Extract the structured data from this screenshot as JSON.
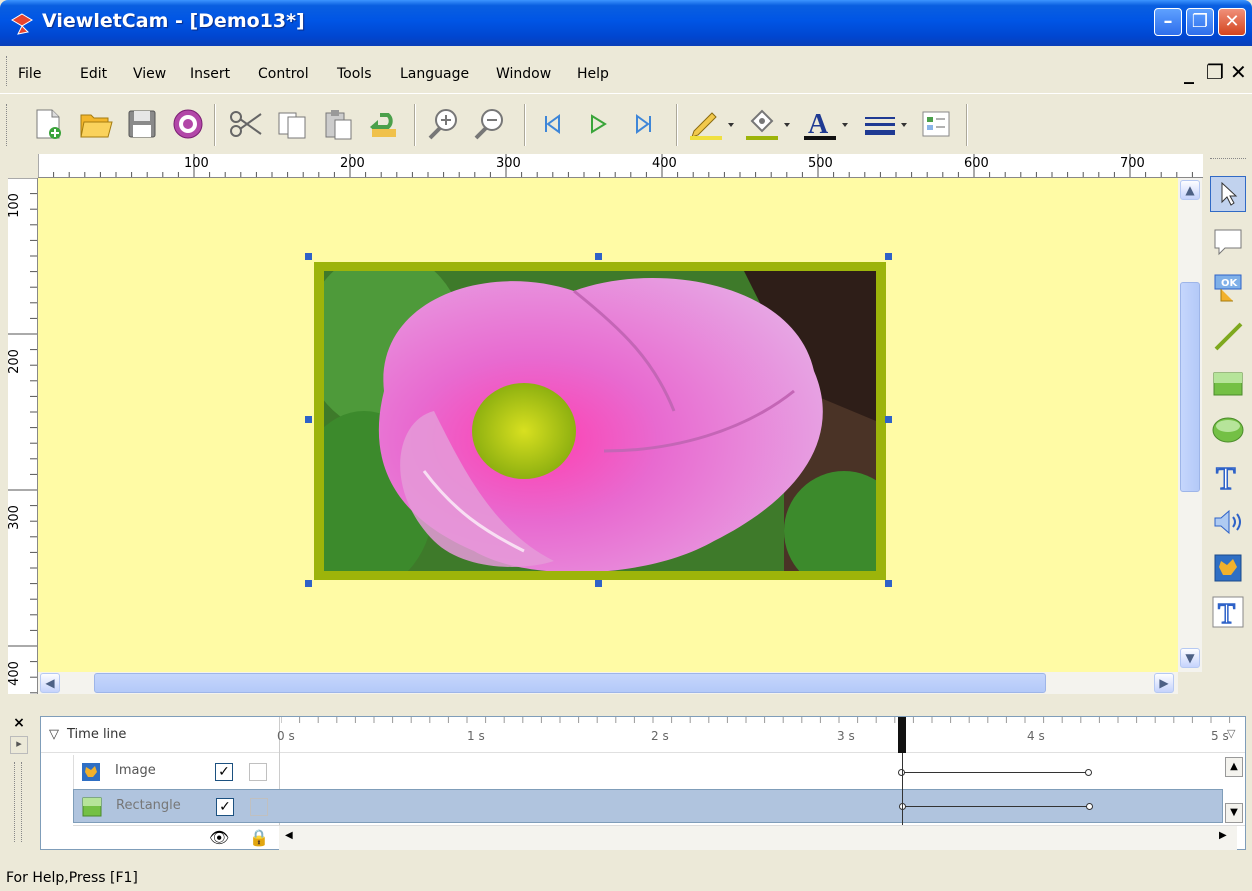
{
  "window": {
    "title": "ViewletCam - [Demo13*]"
  },
  "menu": [
    "File",
    "Edit",
    "View",
    "Insert",
    "Control",
    "Tools",
    "Language",
    "Window",
    "Help"
  ],
  "mdi_controls": {
    "minimize": "_",
    "restore": "❐",
    "close": "✕"
  },
  "toolbar": {
    "buttons": [
      "new-file",
      "open-folder",
      "save",
      "record",
      "cut",
      "copy",
      "paste",
      "undo",
      "zoom-in",
      "zoom-out",
      "skip-start",
      "play",
      "skip-end",
      "line-color",
      "fill-color",
      "font-color",
      "line-style",
      "properties"
    ]
  },
  "rulers": {
    "horizontal_labels": [
      "100",
      "200",
      "300",
      "400",
      "500",
      "600",
      "700"
    ],
    "vertical_labels": [
      "100",
      "200",
      "300",
      "400"
    ]
  },
  "timeline": {
    "header": "Time line",
    "time_labels": [
      "0 s",
      "1 s",
      "2 s",
      "3 s",
      "4 s",
      "5 s"
    ],
    "rows": [
      {
        "label": "Image",
        "visible": true,
        "locked": false,
        "selected": false
      },
      {
        "label": "Rectangle",
        "visible": true,
        "locked": false,
        "selected": true
      }
    ]
  },
  "status": {
    "text": "For Help,Press [F1]"
  },
  "colors": {
    "canvas": "#FFFBA5",
    "selection_row": "#B0C4DE",
    "frame_border": "#9DB40A"
  }
}
